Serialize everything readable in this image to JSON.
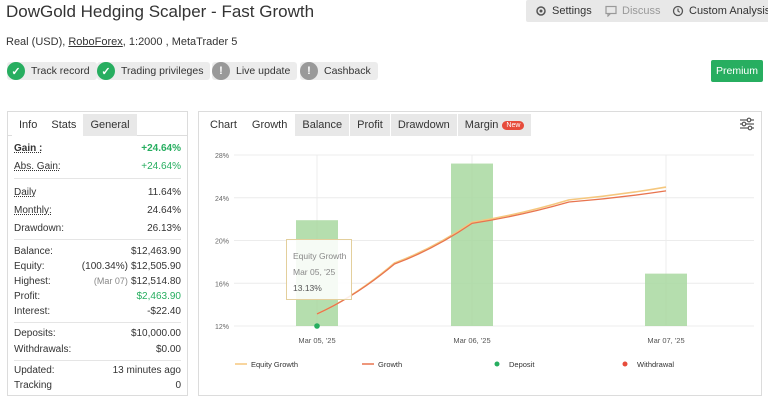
{
  "header": {
    "title": "DowGold Hedging Scalper - Fast Growth",
    "buttons": {
      "settings": "Settings",
      "discuss": "Discuss",
      "custom_analysis": "Custom Analysis"
    },
    "account_prefix": "Real (USD),",
    "broker": "RoboForex",
    "account_suffix": ", 1:2000 , MetaTrader 5",
    "badges": [
      "Track record",
      "Trading privileges",
      "Live update",
      "Cashback"
    ],
    "premium": "Premium"
  },
  "stats": {
    "tabs": [
      "Info",
      "Stats",
      "General"
    ],
    "gain_label": "Gain :",
    "gain": "+24.64%",
    "abs_gain_label": "Abs. Gain:",
    "abs_gain": "+24.64%",
    "daily_label": "Daily",
    "daily": "11.64%",
    "monthly_label": "Monthly:",
    "monthly": "24.64%",
    "drawdown_label": "Drawdown:",
    "drawdown": "26.13%",
    "balance_label": "Balance:",
    "balance": "$12,463.90",
    "equity_label": "Equity:",
    "equity_pct": "(100.34%)",
    "equity": "$12,505.90",
    "highest_label": "Highest:",
    "highest_date": "(Mar 07)",
    "highest": "$12,514.80",
    "profit_label": "Profit:",
    "profit": "$2,463.90",
    "interest_label": "Interest:",
    "interest": "-$22.40",
    "deposits_label": "Deposits:",
    "deposits": "$10,000.00",
    "withdrawals_label": "Withdrawals:",
    "withdrawals": "$0.00",
    "updated_label": "Updated:",
    "updated": "13 minutes ago",
    "tracking_label": "Tracking",
    "tracking": "0"
  },
  "chart_tabs": {
    "tabs": [
      "Chart",
      "Growth",
      "Balance",
      "Profit",
      "Drawdown",
      "Margin"
    ],
    "new_badge": "New"
  },
  "tooltip": {
    "series": "Equity Growth",
    "date": "Mar 05, '25",
    "value": "13.13%"
  },
  "chart_data": {
    "type": "bar",
    "categories": [
      "Mar 05, '25",
      "Mar 06, '25",
      "Mar 07, '25"
    ],
    "y_ticks": [
      "28%",
      "24%",
      "20%",
      "16%",
      "12%"
    ],
    "ylim": [
      12,
      28
    ],
    "series": [
      {
        "name": "Equity Growth",
        "type": "line",
        "x": [
          0,
          0.5,
          1,
          1.5,
          2
        ],
        "values": [
          13.13,
          17.9,
          21.7,
          23.8,
          25.0
        ]
      },
      {
        "name": "Growth",
        "type": "line",
        "x": [
          0,
          0.5,
          1,
          1.5,
          2
        ],
        "values": [
          13.13,
          17.8,
          21.6,
          23.6,
          24.64
        ]
      },
      {
        "name": "Deposit",
        "type": "scatter",
        "x": [
          0
        ],
        "values": [
          12
        ]
      },
      {
        "name": "Withdrawal",
        "type": "scatter",
        "x": [],
        "values": []
      }
    ],
    "bars": [
      {
        "x": 0,
        "value": 21.9
      },
      {
        "x": 1,
        "value": 27.2
      },
      {
        "x": 2,
        "value": 16.9
      }
    ],
    "legend": [
      "Equity Growth",
      "Growth",
      "Deposit",
      "Withdrawal"
    ],
    "colors": {
      "equity": "#f5c77e",
      "growth": "#e8744f",
      "bar": "#a8d8a0",
      "deposit": "#27ae60",
      "withdrawal": "#e74c3c"
    },
    "grid": true,
    "legend_position": "bottom"
  }
}
